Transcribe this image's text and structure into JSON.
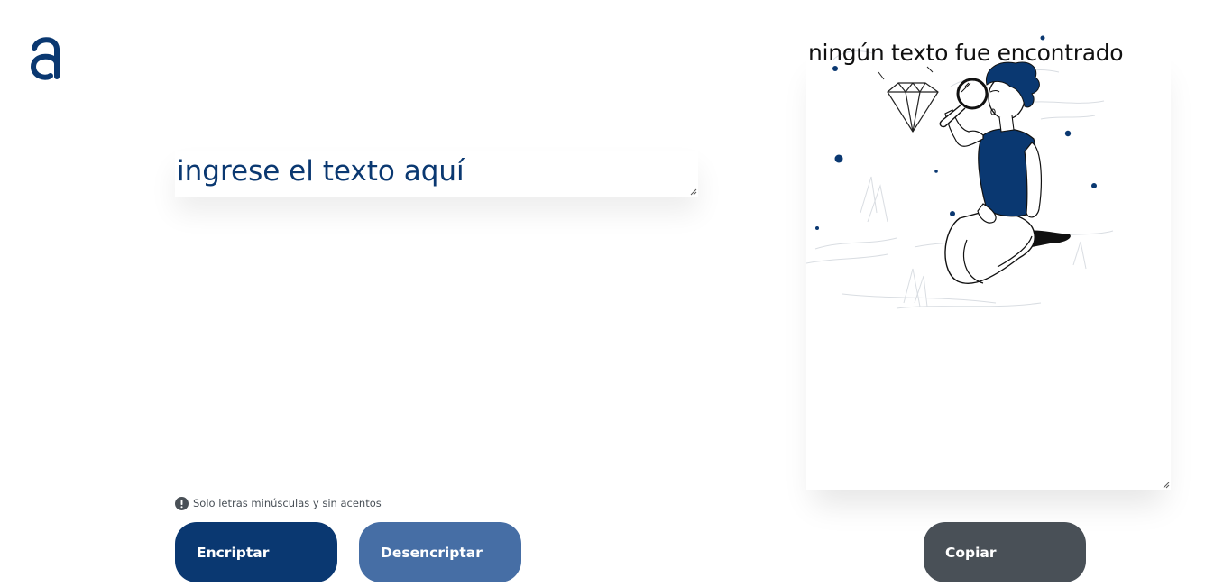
{
  "app": {
    "logo_icon": "alura-a-logo-icon",
    "accent_color": "#0a3871"
  },
  "input": {
    "placeholder": "ingrese el texto aquí",
    "value": ""
  },
  "hint": {
    "icon": "exclamation-circle-icon",
    "text": "Solo letras minúsculas y sin acentos"
  },
  "actions": {
    "encrypt_label": "Encriptar",
    "decrypt_label": "Desencriptar",
    "copy_label": "Copiar",
    "encrypt_color": "#0a3871",
    "decrypt_color": "#466ea5",
    "copy_color": "#495057"
  },
  "output": {
    "empty_title": "ningún texto fue encontrado",
    "illustration": "person-with-magnifying-glass-illustration",
    "value": ""
  }
}
